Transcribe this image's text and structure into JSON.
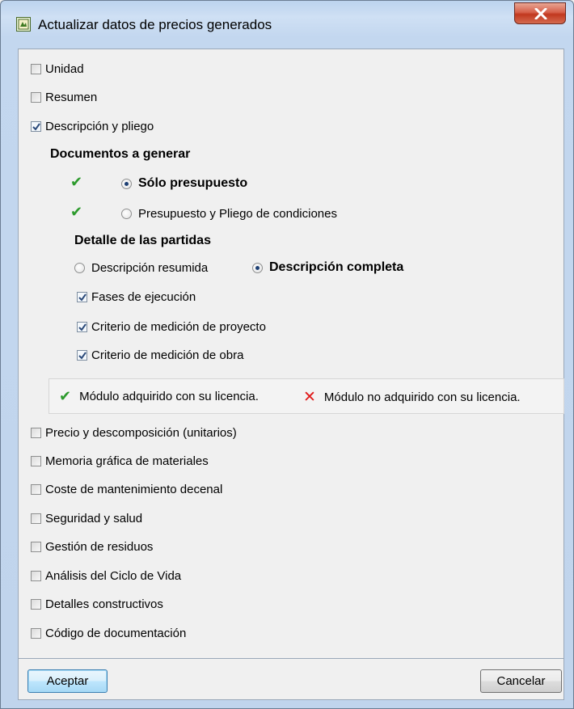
{
  "window": {
    "title": "Actualizar datos de precios generados",
    "close_icon": "close-x-icon"
  },
  "top_options": [
    {
      "label": "Unidad",
      "checked": false
    },
    {
      "label": "Resumen",
      "checked": false
    },
    {
      "label": "Descripción y pliego",
      "checked": true
    }
  ],
  "documents": {
    "heading": "Documentos a generar",
    "options": [
      {
        "label": "Sólo presupuesto",
        "selected": true,
        "licensed": true
      },
      {
        "label": "Presupuesto y Pliego de condiciones",
        "selected": false,
        "licensed": true
      }
    ]
  },
  "detail": {
    "heading": "Detalle de las partidas",
    "options": [
      {
        "label": "Descripción resumida",
        "selected": false
      },
      {
        "label": "Descripción completa",
        "selected": true
      }
    ],
    "sub_options": [
      {
        "label": "Fases de ejecución",
        "checked": true
      },
      {
        "label": "Criterio de medición de proyecto",
        "checked": true
      },
      {
        "label": "Criterio de medición de obra",
        "checked": true
      }
    ]
  },
  "legend": {
    "licensed_label": "Módulo adquirido con su licencia.",
    "not_licensed_label": "Módulo no adquirido con su licencia.",
    "licensed_color": "#2c9a2c",
    "not_licensed_color": "#e01919"
  },
  "bottom_options": [
    {
      "label": "Precio y descomposición (unitarios)",
      "checked": false
    },
    {
      "label": "Memoria gráfica de materiales",
      "checked": false
    },
    {
      "label": "Coste de mantenimiento decenal",
      "checked": false
    },
    {
      "label": "Seguridad y salud",
      "checked": false
    },
    {
      "label": "Gestión de residuos",
      "checked": false
    },
    {
      "label": "Análisis del Ciclo de Vida",
      "checked": false
    },
    {
      "label": "Detalles constructivos",
      "checked": false
    },
    {
      "label": "Código de documentación",
      "checked": false
    }
  ],
  "buttons": {
    "accept_label": "Aceptar",
    "cancel_label": "Cancelar"
  }
}
